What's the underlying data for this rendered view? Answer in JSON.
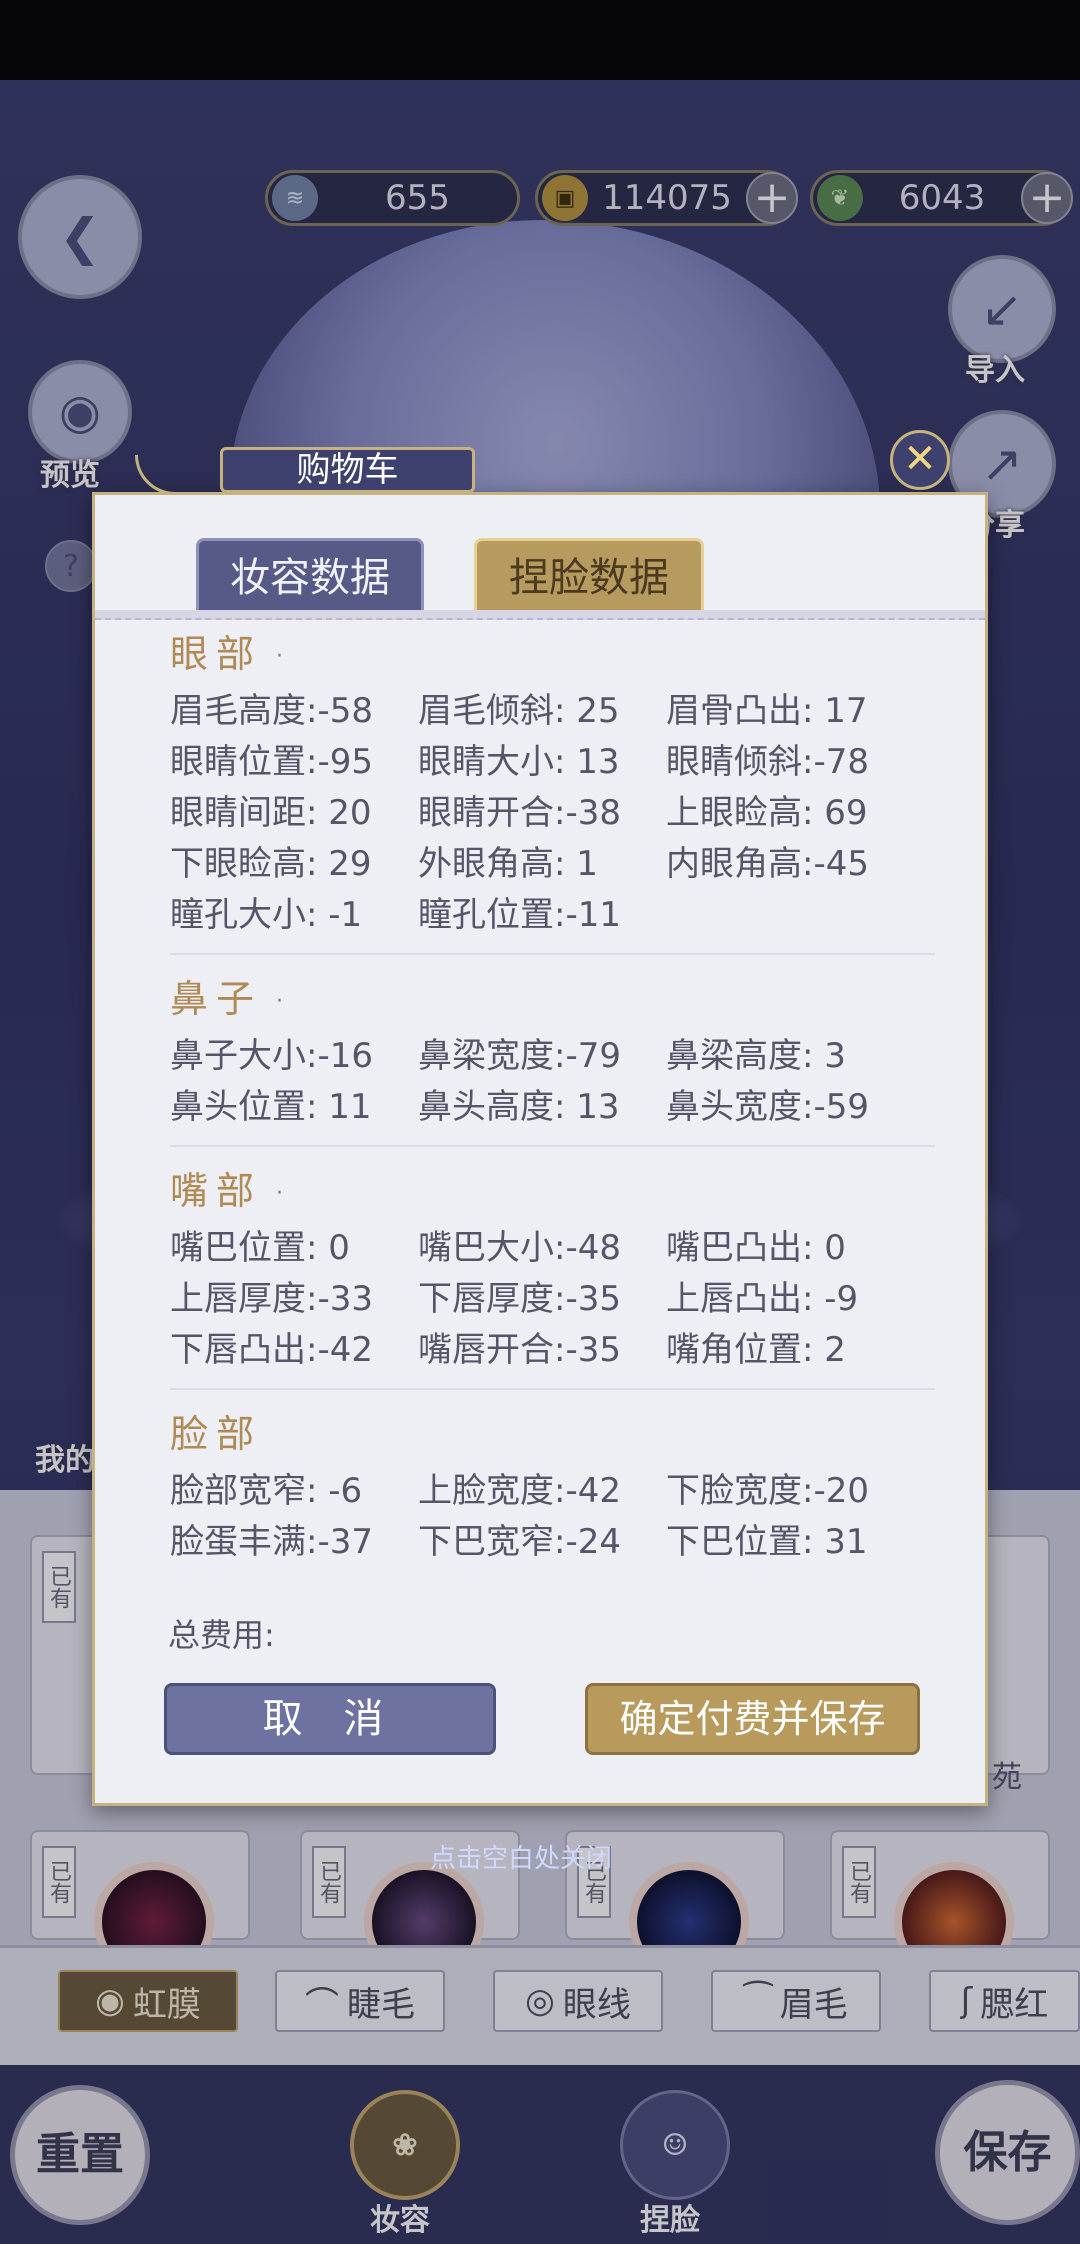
{
  "currency": {
    "shell": "655",
    "copper": "114075",
    "jade": "6043",
    "plus": "+"
  },
  "side": {
    "preview": "预览",
    "import": "导入",
    "share": "分享",
    "help": "?",
    "my": "我的"
  },
  "dialog": {
    "title": "购物车",
    "close": "✕",
    "tabs": {
      "makeup": "妆容数据",
      "face": "捏脸数据"
    },
    "sections": [
      {
        "title": "眼部",
        "items": [
          "眉毛高度:-58",
          "眉毛倾斜: 25",
          "眉骨凸出: 17",
          "眼睛位置:-95",
          "眼睛大小: 13",
          "眼睛倾斜:-78",
          "眼睛间距: 20",
          "眼睛开合:-38",
          "上眼睑高: 69",
          "下眼睑高: 29",
          "外眼角高:  1",
          "内眼角高:-45",
          "瞳孔大小: -1",
          "瞳孔位置:-11"
        ]
      },
      {
        "title": "鼻子",
        "items": [
          "鼻子大小:-16",
          "鼻梁宽度:-79",
          "鼻梁高度:  3",
          "鼻头位置: 11",
          "鼻头高度: 13",
          "鼻头宽度:-59"
        ]
      },
      {
        "title": "嘴部",
        "items": [
          "嘴巴位置:  0",
          "嘴巴大小:-48",
          "嘴巴凸出:  0",
          "上唇厚度:-33",
          "下唇厚度:-35",
          "上唇凸出: -9",
          "下唇凸出:-42",
          "嘴唇开合:-35",
          "嘴角位置:  2"
        ]
      },
      {
        "title": "脸部",
        "items": [
          "脸部宽窄: -6",
          "上脸宽度:-42",
          "下脸宽度:-20",
          "脸蛋丰满:-37",
          "下巴宽窄:-24",
          "下巴位置: 31"
        ]
      }
    ],
    "total_label": "总费用:",
    "cancel": "取 消",
    "confirm": "确定付费并保存"
  },
  "dismiss_hint": "点击空白处关闭",
  "cards": {
    "owned": "已有",
    "label_right": "苑"
  },
  "categories": [
    "虹膜",
    "睫毛",
    "眼线",
    "眉毛",
    "腮红"
  ],
  "bottom": {
    "reset": "重置",
    "save": "保存",
    "makeup": "妆容",
    "face": "捏脸"
  }
}
